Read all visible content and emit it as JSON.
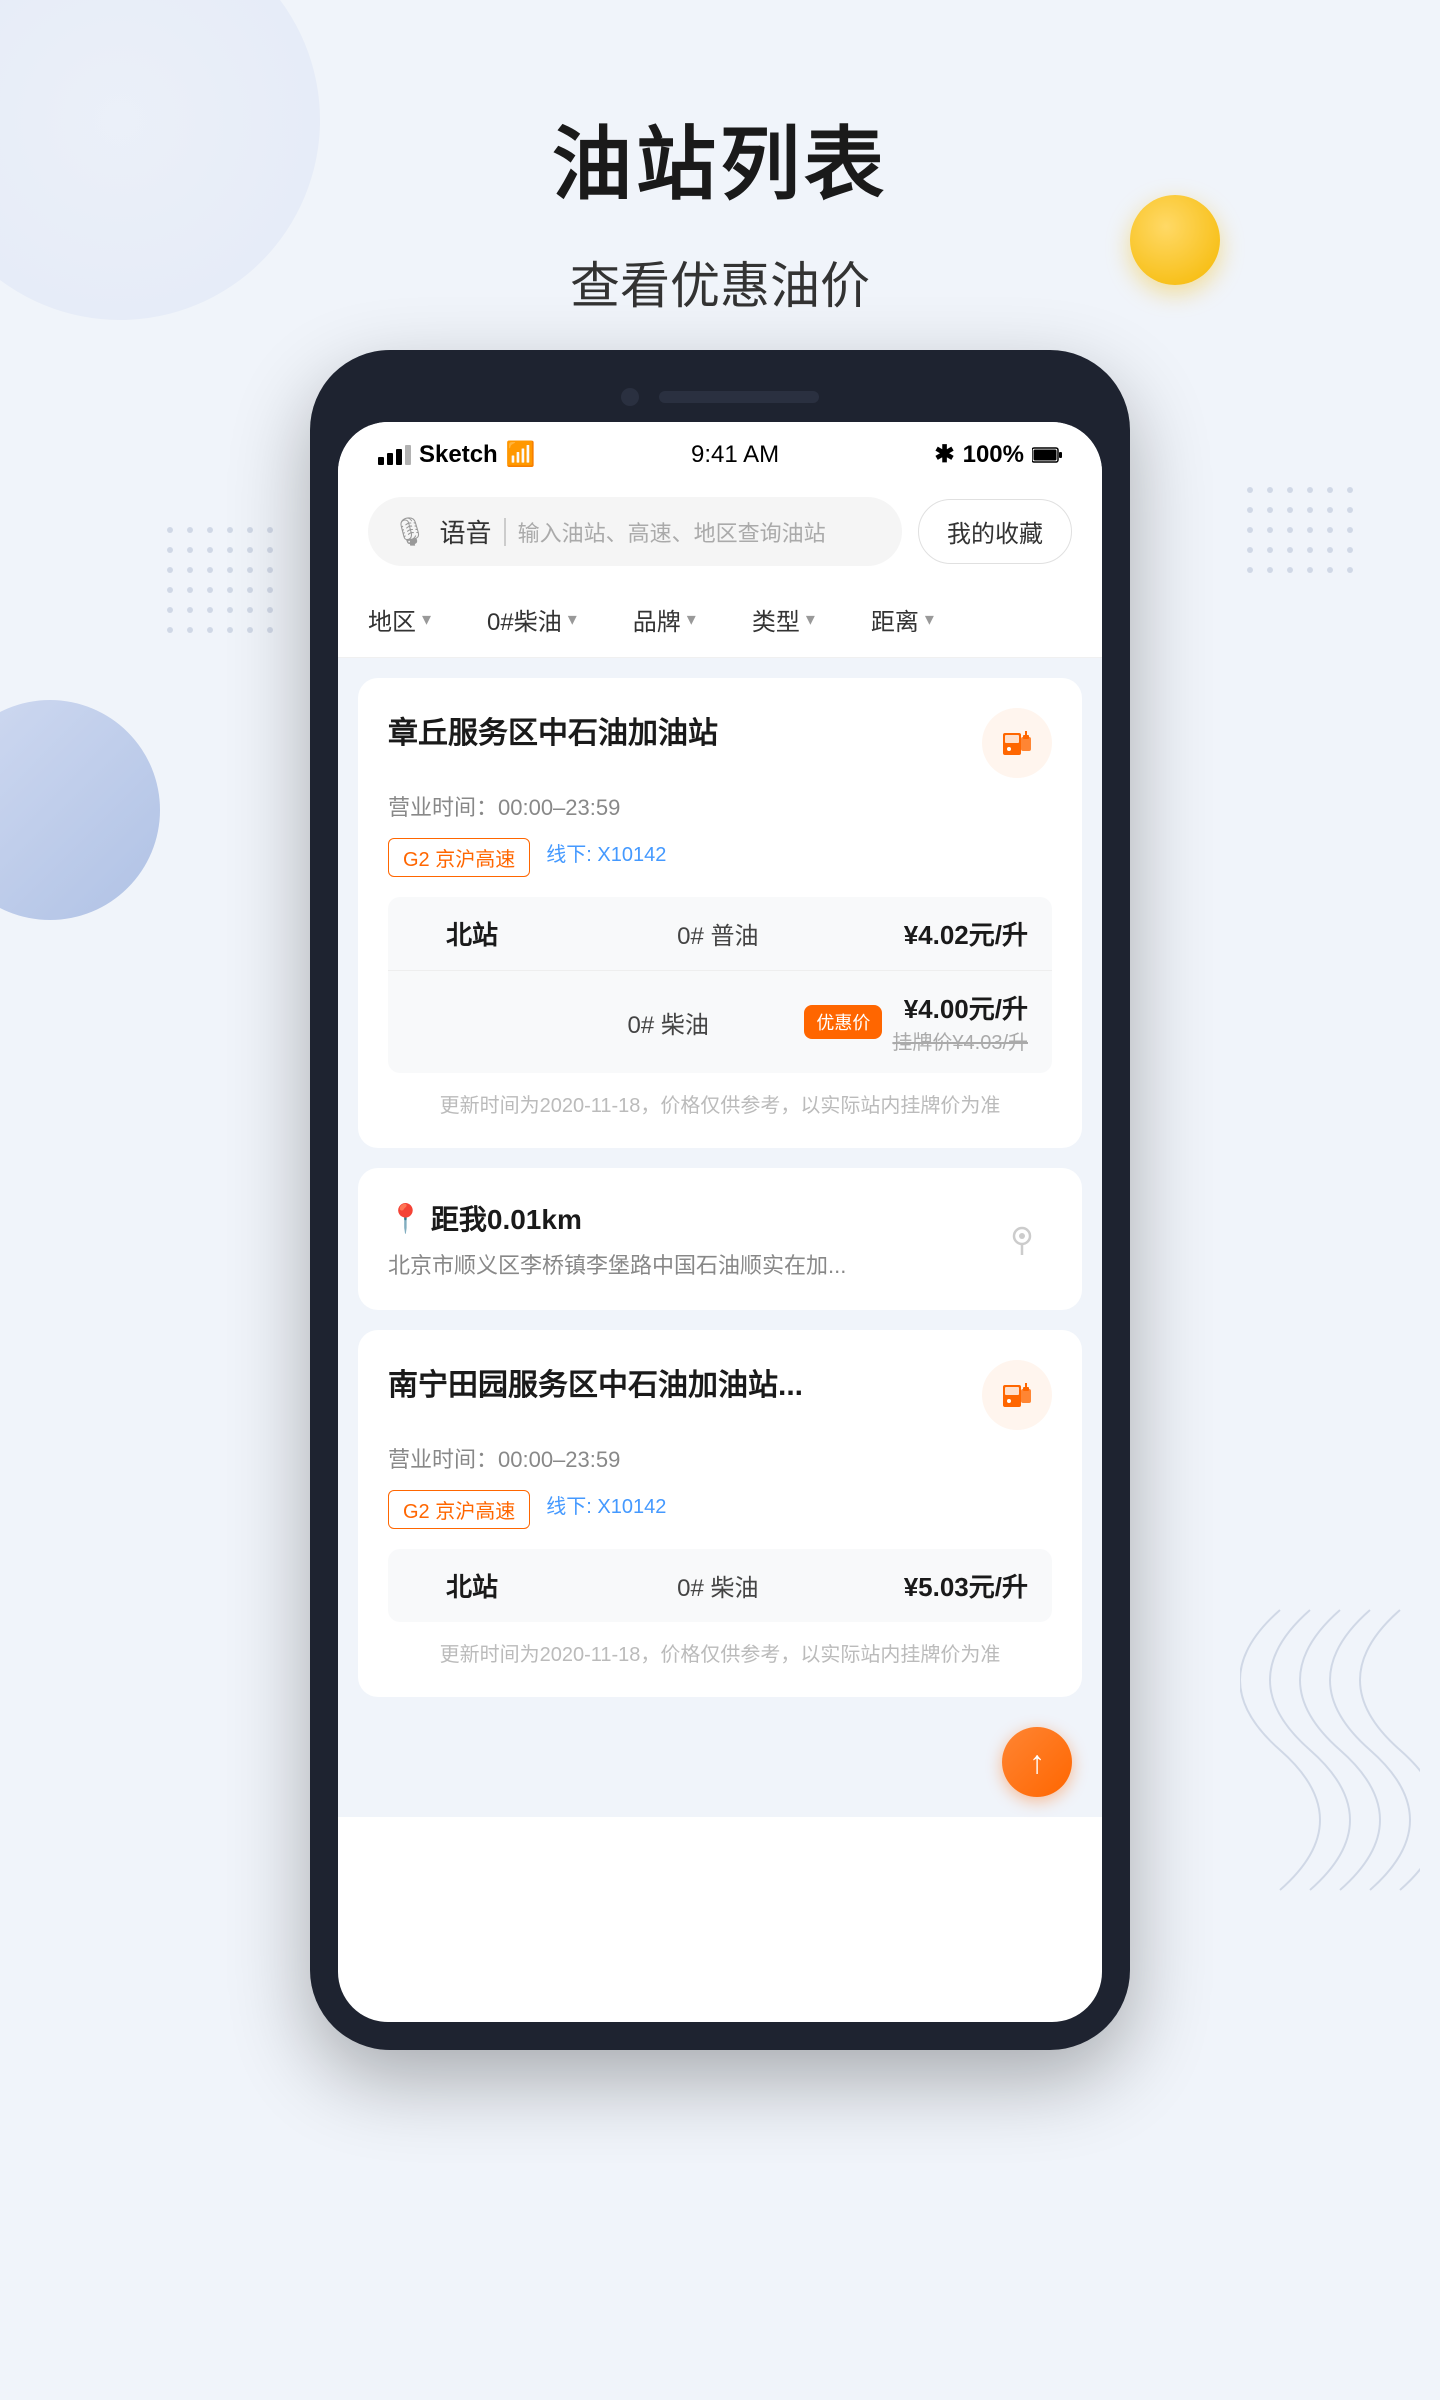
{
  "page": {
    "title": "油站列表",
    "subtitle": "查看优惠油价"
  },
  "statusBar": {
    "carrier": "Sketch",
    "time": "9:41 AM",
    "battery": "100%"
  },
  "searchBar": {
    "voiceLabel": "语音",
    "placeholder": "输入油站、高速、地区查询油站",
    "collectionBtn": "我的收藏"
  },
  "filters": [
    {
      "label": "地区"
    },
    {
      "label": "0#柴油"
    },
    {
      "label": "品牌"
    },
    {
      "label": "类型"
    },
    {
      "label": "距离"
    }
  ],
  "stations": [
    {
      "name": "章丘服务区中石油加油站",
      "hours": "营业时间：00:00–23:59",
      "tags": [
        {
          "type": "highway",
          "label": "G2 京沪高速"
        },
        {
          "type": "line",
          "label": "线下: X10142"
        }
      ],
      "subStation": "北站",
      "fuels": [
        {
          "type": "0# 普油",
          "price": "¥4.02元/升",
          "discount": false
        },
        {
          "type": "0# 柴油",
          "price": "¥4.00元/升",
          "originalPrice": "挂牌价¥4.03/升",
          "discount": true,
          "discountLabel": "优惠价"
        }
      ],
      "updateTime": "更新时间为2020-11-18，价格仅供参考，以实际站内挂牌价为准"
    },
    {
      "name": "南宁田园服务区中石油加油站...",
      "hours": "营业时间：00:00–23:59",
      "tags": [
        {
          "type": "highway",
          "label": "G2 京沪高速"
        },
        {
          "type": "line",
          "label": "线下: X10142"
        }
      ],
      "subStation": "北站",
      "fuels": [
        {
          "type": "0# 柴油",
          "price": "¥5.03元/升",
          "discount": false
        }
      ],
      "updateTime": "更新时间为2020-11-18，价格仅供参考，以实际站内挂牌价为准"
    }
  ],
  "locationCard": {
    "distance": "距我0.01km",
    "address": "北京市顺义区李桥镇李堡路中国石油顺实在加..."
  }
}
